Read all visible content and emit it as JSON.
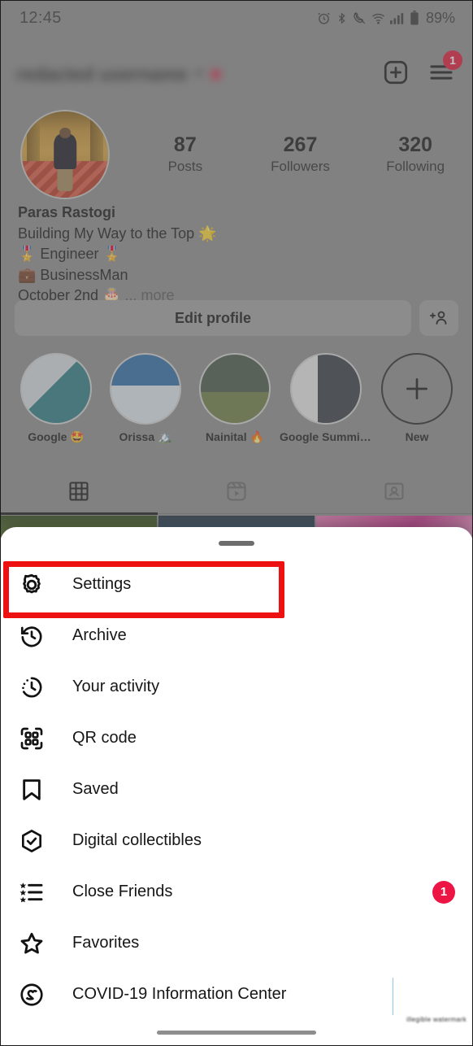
{
  "status_bar": {
    "time": "12:45",
    "battery_percent": "89%",
    "icons": [
      "alarm-icon",
      "bluetooth-icon",
      "call-mute-icon",
      "wifi-icon",
      "signal-icon",
      "battery-icon"
    ]
  },
  "header": {
    "username": "redacted username",
    "username_blurred": true,
    "new_post_icon": "plus-box-icon",
    "menu_icon": "hamburger-icon",
    "menu_badge": "1"
  },
  "profile": {
    "avatar_alt": "profile-photo",
    "name": "Paras Rastogi",
    "bio_lines": [
      "Building My Way to the Top 🌟",
      "🎖️ Engineer 🎖️",
      "💼 BusinessMan",
      "October 2nd 🎂"
    ],
    "more_label": "... more",
    "stats": [
      {
        "value": "87",
        "label": "Posts"
      },
      {
        "value": "267",
        "label": "Followers"
      },
      {
        "value": "320",
        "label": "Following"
      }
    ]
  },
  "actions": {
    "edit_profile_label": "Edit profile",
    "add_person_icon": "person-add-icon"
  },
  "highlights": [
    {
      "label": "Google 🤩",
      "art": "hl-img-google"
    },
    {
      "label": "Orissa 🏔️",
      "art": "hl-img-orissa"
    },
    {
      "label": "Nainital 🔥",
      "art": "hl-img-nainital"
    },
    {
      "label": "Google Summit❤️",
      "art": "hl-img-summit"
    },
    {
      "label": "New",
      "art": "hl-new"
    }
  ],
  "tabs": [
    {
      "name": "grid-tab",
      "icon": "grid-icon",
      "active": true
    },
    {
      "name": "reels-tab",
      "icon": "reels-icon",
      "active": false
    },
    {
      "name": "tagged-tab",
      "icon": "tagged-icon",
      "active": false
    }
  ],
  "sheet": {
    "handle": "drag-handle",
    "items": [
      {
        "label": "Settings",
        "icon": "gear-icon",
        "badge": ""
      },
      {
        "label": "Archive",
        "icon": "archive-clock-icon",
        "badge": ""
      },
      {
        "label": "Your activity",
        "icon": "activity-clock-icon",
        "badge": ""
      },
      {
        "label": "QR code",
        "icon": "qr-code-icon",
        "badge": ""
      },
      {
        "label": "Saved",
        "icon": "bookmark-icon",
        "badge": ""
      },
      {
        "label": "Digital collectibles",
        "icon": "hexagon-check-icon",
        "badge": ""
      },
      {
        "label": "Close Friends",
        "icon": "close-friends-list-icon",
        "badge": "1"
      },
      {
        "label": "Favorites",
        "icon": "star-icon",
        "badge": ""
      },
      {
        "label": "COVID-19 Information Center",
        "icon": "covid-heart-icon",
        "badge": ""
      }
    ]
  },
  "annotation": {
    "highlight_target": "Settings",
    "color": "#ee1111"
  },
  "watermark": {
    "text": "illegible watermark"
  }
}
